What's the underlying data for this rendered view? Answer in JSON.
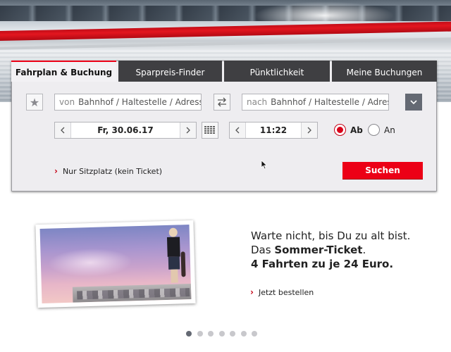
{
  "tabs": [
    {
      "label": "Fahrplan & Buchung",
      "active": true
    },
    {
      "label": "Sparpreis-Finder",
      "active": false
    },
    {
      "label": "Pünktlichkeit",
      "active": false
    },
    {
      "label": "Meine Buchungen",
      "active": false
    }
  ],
  "journey": {
    "from_prefix": "von",
    "from_placeholder": "Bahnhof / Haltestelle / Adresse",
    "to_prefix": "nach",
    "to_placeholder": "Bahnhof / Haltestelle / Adresse"
  },
  "date": {
    "value": "Fr, 30.06.17"
  },
  "time": {
    "value": "11:22"
  },
  "time_mode": {
    "options": [
      "Ab",
      "An"
    ],
    "selected": "Ab"
  },
  "seat_link": "Nur Sitzplatz (kein Ticket)",
  "search_button": "Suchen",
  "promo": {
    "line1": "Warte nicht, bis Du zu alt bist.",
    "line2_prefix": "Das ",
    "line2_bold": "Sommer-Ticket",
    "line2_suffix": ".",
    "line3": "4 Fahrten zu je 24 Euro.",
    "link": "Jetzt bestellen"
  },
  "carousel": {
    "count": 7,
    "active_index": 0
  },
  "colors": {
    "accent_red": "#ec0016",
    "tab_dark": "#3f3f42",
    "card_bg": "#eeedf0"
  },
  "icons": [
    "star-icon",
    "swap-icon",
    "chevron-down-icon",
    "chevron-left-icon",
    "chevron-right-icon",
    "calendar-icon",
    "mouse-cursor-icon"
  ]
}
